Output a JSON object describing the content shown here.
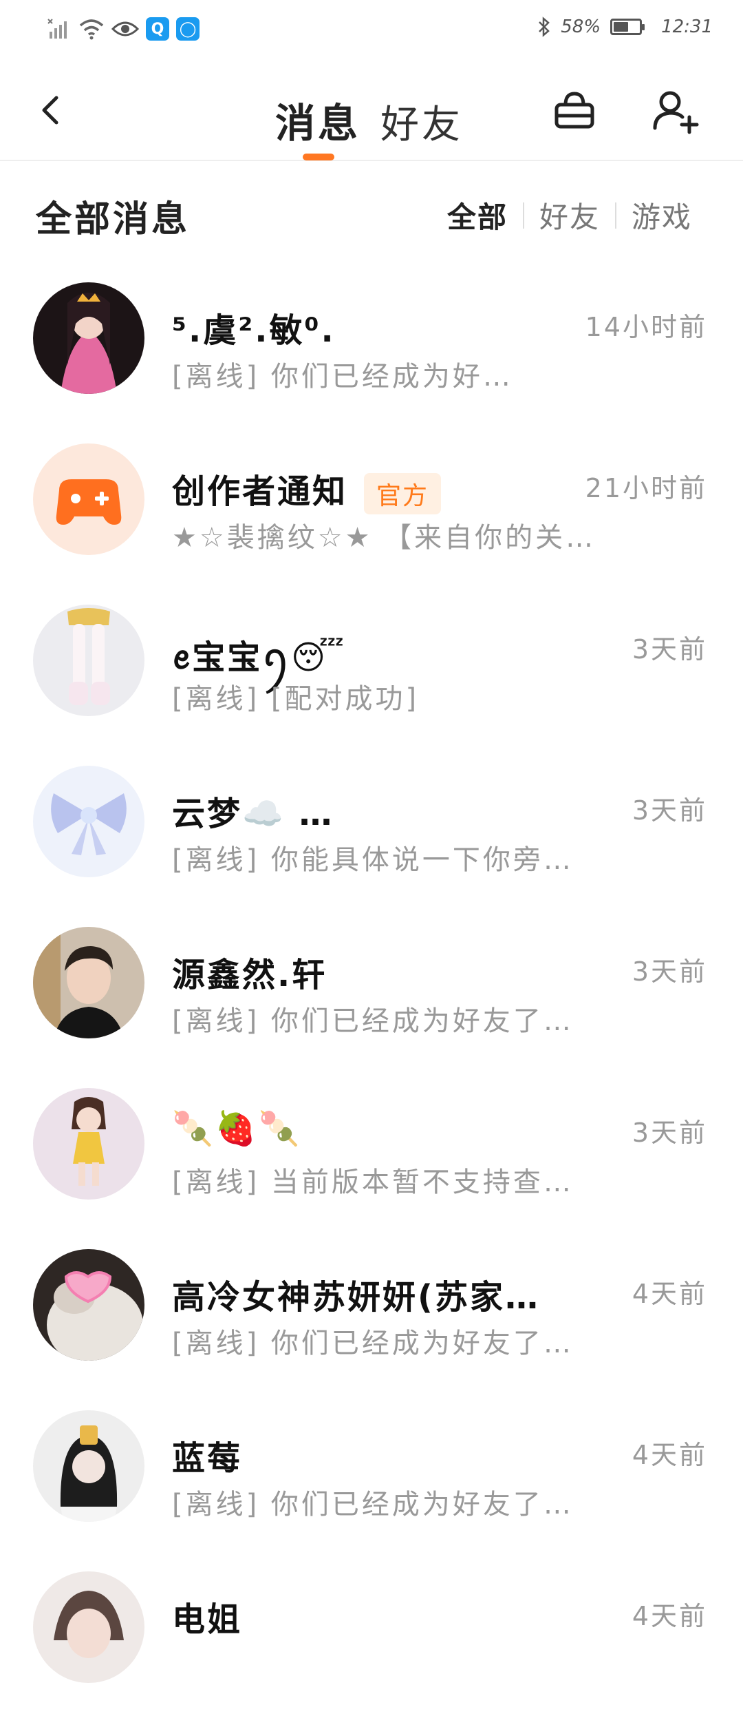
{
  "status_bar": {
    "battery": "58%",
    "battery_level": 0.58,
    "time": "12:31",
    "icons": [
      "signal-off-icon",
      "wifi-icon",
      "eye-icon",
      "search-app-icon",
      "bulb-app-icon",
      "bluetooth-icon",
      "battery-icon"
    ]
  },
  "nav": {
    "tab_messages": "消息",
    "tab_friends": "好友",
    "icons": [
      "back-icon",
      "shop-basket-icon",
      "add-friend-icon"
    ]
  },
  "filter": {
    "title": "全部消息",
    "options": [
      "全部",
      "好友",
      "游戏"
    ],
    "active": "全部"
  },
  "colors": {
    "accent": "#ff7722",
    "official_badge_text": "#ff7a1a",
    "official_badge_bg": "#fff0e2"
  },
  "messages": [
    {
      "name": "⁵.虞².敏⁰.",
      "preview": "[离线] 你们已经成为好…",
      "time": "14小时前",
      "badge": ""
    },
    {
      "name": "创作者通知",
      "preview": "★☆裴擒纹☆★ 【来自你的关注】",
      "time": "21小时前",
      "badge": "官方"
    },
    {
      "name": "ꫀ宝宝ꪆ😴",
      "preview": "[离线] [配对成功]",
      "time": "3天前",
      "badge": ""
    },
    {
      "name": "云梦☁️ …",
      "preview": "[离线] 你能具体说一下你旁…",
      "time": "3天前",
      "badge": ""
    },
    {
      "name": "源鑫然.轩",
      "preview": "[离线] 你们已经成为好友了…",
      "time": "3天前",
      "badge": ""
    },
    {
      "name": "🍡🍓🍡",
      "preview": "[离线] 当前版本暂不支持查…",
      "time": "3天前",
      "badge": ""
    },
    {
      "name": "高冷女神苏妍妍(苏家…",
      "preview": "[离线] 你们已经成为好友了…",
      "time": "4天前",
      "badge": ""
    },
    {
      "name": "蓝莓",
      "preview": "[离线] 你们已经成为好友了…",
      "time": "4天前",
      "badge": ""
    },
    {
      "name": "电姐",
      "preview": "",
      "time": "4天前",
      "badge": ""
    }
  ]
}
